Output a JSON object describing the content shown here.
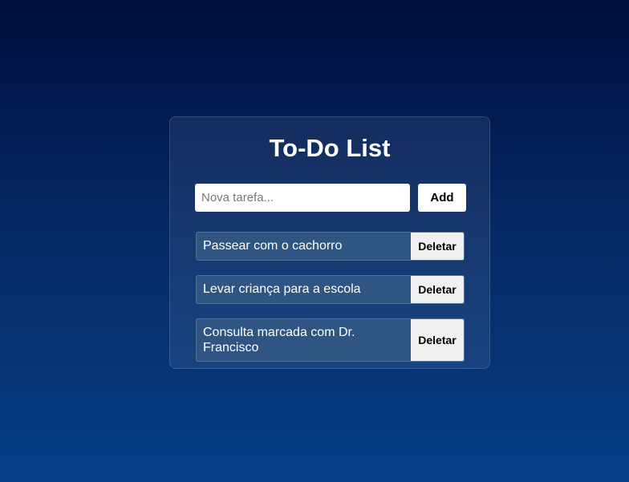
{
  "app": {
    "title": "To-Do List"
  },
  "new_task": {
    "placeholder": "Nova tarefa...",
    "value": "",
    "add_label": "Add"
  },
  "tasks": [
    {
      "text": "Passear com o cachorro",
      "delete_label": "Deletar"
    },
    {
      "text": "Levar criança para a escola",
      "delete_label": "Deletar"
    },
    {
      "text": "Consulta marcada com Dr. Francisco",
      "delete_label": "Deletar"
    }
  ],
  "colors": {
    "background_top": "#000f3d",
    "background_bottom": "#063f86",
    "task_bg": "#2f5582",
    "button_bg": "#ffffff",
    "delete_bg": "#f0f0f0"
  }
}
